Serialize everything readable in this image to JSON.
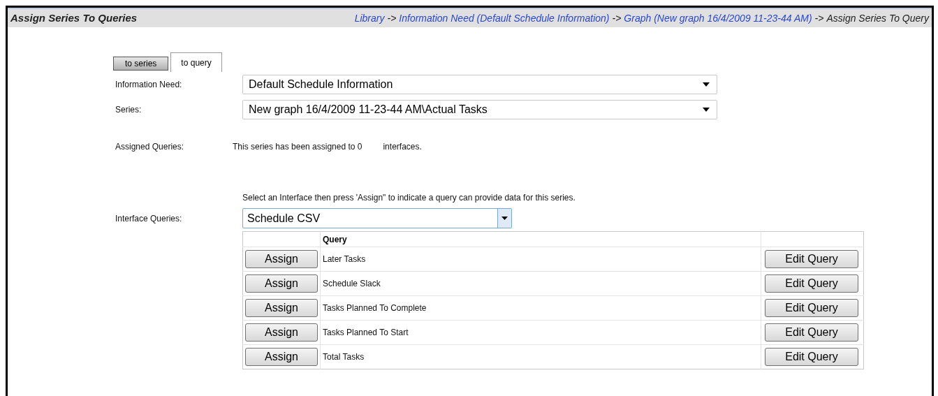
{
  "header": {
    "title": "Assign Series To Queries",
    "breadcrumb": [
      {
        "label": "Library",
        "kind": "link"
      },
      {
        "label": "->",
        "kind": "separator"
      },
      {
        "label": "Information Need (Default Schedule Information)",
        "kind": "link"
      },
      {
        "label": "->",
        "kind": "separator"
      },
      {
        "label": "Graph (New graph 16/4/2009 11-23-44 AM)",
        "kind": "link"
      },
      {
        "label": "->",
        "kind": "separator"
      },
      {
        "label": "Assign Series To Query",
        "kind": "current"
      }
    ]
  },
  "tabs": [
    {
      "label": "to series",
      "selected": false
    },
    {
      "label": "to query",
      "selected": true
    }
  ],
  "fields": [
    {
      "label": "Information Need:",
      "value": "Default Schedule Information"
    },
    {
      "label": "Series:",
      "value": "New graph 16/4/2009 11-23-44 AM\\Actual Tasks"
    }
  ],
  "assigned": {
    "label": "Assigned Queries:",
    "text": "This series has been assigned to 0",
    "suffix": "interfaces."
  },
  "instruction": "Select an Interface then press 'Assign\" to indicate a query can provide data for this series.",
  "interface": {
    "label": "Interface Queries:",
    "value": "Schedule CSV"
  },
  "table": {
    "columns": [
      "Query"
    ],
    "rows": [
      {
        "assign": "Assign",
        "query": "Later Tasks",
        "edit": "Edit Query"
      },
      {
        "assign": "Assign",
        "query": "Schedule Slack",
        "edit": "Edit Query"
      },
      {
        "assign": "Assign",
        "query": "Tasks Planned To Complete",
        "edit": "Edit Query"
      },
      {
        "assign": "Assign",
        "query": "Tasks Planned To Start",
        "edit": "Edit Query"
      },
      {
        "assign": "Assign",
        "query": "Total Tasks",
        "edit": "Edit Query"
      }
    ]
  }
}
